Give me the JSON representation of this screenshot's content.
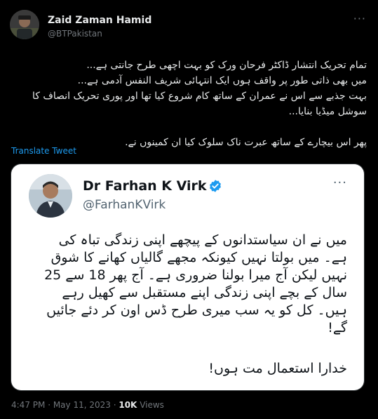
{
  "author": {
    "name": "Zaid Zaman Hamid",
    "handle": "@BTPakistan"
  },
  "tweet": {
    "lines": [
      "تمام تحریک انتشار ڈاکٹر فرحان ورک کو بہت اچھی طرح جانتی ہے...",
      "میں بھی ذاتی طور پر واقف ہوں ایک انتہائی شریف النفس آدمی ہے...",
      "بہت جذبے سے اس نے عمران کے ساتھ کام شروع کیا تھا اور پوری تحریک انصاف کا",
      "سوشل میڈیا بنایا...",
      "",
      "پھر اس بیچارے کے ساتھ عبرت ناک سلوک کیا ان کمینوں نے."
    ],
    "translate_label": "Translate Tweet"
  },
  "quoted": {
    "name": "Dr Farhan K Virk",
    "handle": "@FarhanKVirk",
    "lines": [
      "میں نے ان سیاستدانوں کے پیچھے اپنی زندگی تباہ کی",
      "ہے۔ میں بولتا نہیں کیونکہ مجھے گالیاں کھانے کا شوق",
      "نہیں لیکن آج میرا بولنا ضروری ہے۔ آج پھر 18 سے 25",
      "سال کے بچے اپنی زندگی اپنے مستقبل سے کھیل رہے",
      "ہیں۔ کل کو یہ سب میری طرح ڈس اون کر دئے جائیں",
      "گے!"
    ],
    "closing": "خدارا استعمال مت ہوں!"
  },
  "meta": {
    "time": "4:47 PM",
    "date": "May 11, 2023",
    "views_count": "10K",
    "views_label": "Views"
  },
  "colors": {
    "background": "#000000",
    "text": "#e7e9ea",
    "muted": "#71767b",
    "link": "#1d9bf0",
    "verified": "#1d9bf0"
  }
}
